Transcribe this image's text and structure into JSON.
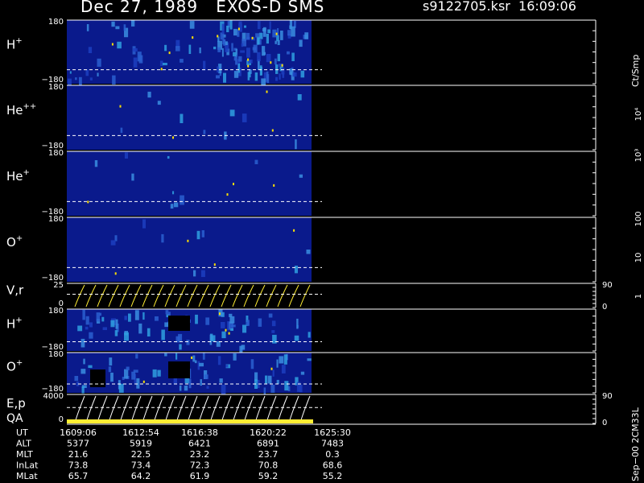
{
  "header": {
    "title": "Dec 27, 1989   EXOS-D SMS",
    "file_info": "s9122705.ksr  16:09:06"
  },
  "colors": {
    "spectrogram_background": "#0a1a8c",
    "no_data": "#000000",
    "overlay_line": "#ffffff",
    "ticks": "#ffd700",
    "qa_bar": "#ffee33"
  },
  "colorbar": {
    "units": "Ct/Smp",
    "tick_labels": [
      "1",
      "10",
      "100",
      "10³",
      "10⁴"
    ],
    "colors": [
      "#0f1f8f",
      "#1c30b0",
      "#2244cc",
      "#3a8ee0",
      "#2fd0d0",
      "#ffffff",
      "#20a060",
      "#40c040",
      "#70d020",
      "#a0e020",
      "#ffff00",
      "#d0c000",
      "#a09000",
      "#887020",
      "#ff2020",
      "#dd0000",
      "#b00000",
      "#900000",
      "#700000",
      "#ffffff"
    ]
  },
  "chart_data": {
    "type": "heatmap",
    "x_axis": {
      "label": "UT",
      "ticks": [
        "1609:06",
        "1612:54",
        "1616:38",
        "1620:22",
        "1625:30"
      ],
      "data_end_tick": "1625:30"
    },
    "panels": [
      {
        "id": "h-plus",
        "label": "H+",
        "base": "H",
        "sup": "+",
        "ylim": [
          -180,
          180
        ],
        "y_ticks": [
          "180",
          "−180"
        ]
      },
      {
        "id": "he-plus-plus",
        "label": "He++",
        "base": "He",
        "sup": "++",
        "ylim": [
          -180,
          180
        ],
        "y_ticks": [
          "180",
          "−180"
        ]
      },
      {
        "id": "he-plus",
        "label": "He+",
        "base": "He",
        "sup": "+",
        "ylim": [
          -180,
          180
        ],
        "y_ticks": [
          "180",
          "−180"
        ]
      },
      {
        "id": "o-plus",
        "label": "O+",
        "base": "O",
        "sup": "+",
        "ylim": [
          -180,
          180
        ],
        "y_ticks": [
          "180",
          "−180"
        ]
      },
      {
        "id": "v-r",
        "label": "V,r",
        "ylim": [
          0,
          25
        ],
        "y_ticks": [
          "25",
          "0"
        ],
        "right_ticks": [
          "90",
          "0"
        ]
      },
      {
        "id": "h-plus-2",
        "label": "H+",
        "base": "H",
        "sup": "+",
        "ylim": [
          -180,
          180
        ],
        "y_ticks": [
          "180",
          "−180"
        ]
      },
      {
        "id": "o-plus-2",
        "label": "O+",
        "base": "O",
        "sup": "+",
        "ylim": [
          -180,
          180
        ],
        "y_ticks": [
          "180",
          "−180"
        ]
      },
      {
        "id": "e-p",
        "label": "E,p",
        "ylim": [
          0,
          4000
        ],
        "y_ticks": [
          "4000",
          "0"
        ],
        "right_ticks": [
          "90",
          "0"
        ]
      }
    ],
    "qa_label": "QA",
    "ephemeris": {
      "rows": [
        {
          "label": "UT",
          "values": [
            "1609:06",
            "1612:54",
            "1616:38",
            "1620:22",
            "1625:30"
          ]
        },
        {
          "label": "ALT",
          "values": [
            "5377",
            "5919",
            "6421",
            "6891",
            "7483"
          ]
        },
        {
          "label": "MLT",
          "values": [
            "21.6",
            "22.5",
            "23.2",
            "23.7",
            "0.3"
          ]
        },
        {
          "label": "InLat",
          "values": [
            "73.8",
            "73.4",
            "72.3",
            "70.8",
            "68.6"
          ]
        },
        {
          "label": "MLat",
          "values": [
            "65.7",
            "64.2",
            "61.9",
            "59.2",
            "55.2"
          ]
        }
      ]
    }
  },
  "footer": {
    "version": "Sep−00 2CM33L"
  }
}
